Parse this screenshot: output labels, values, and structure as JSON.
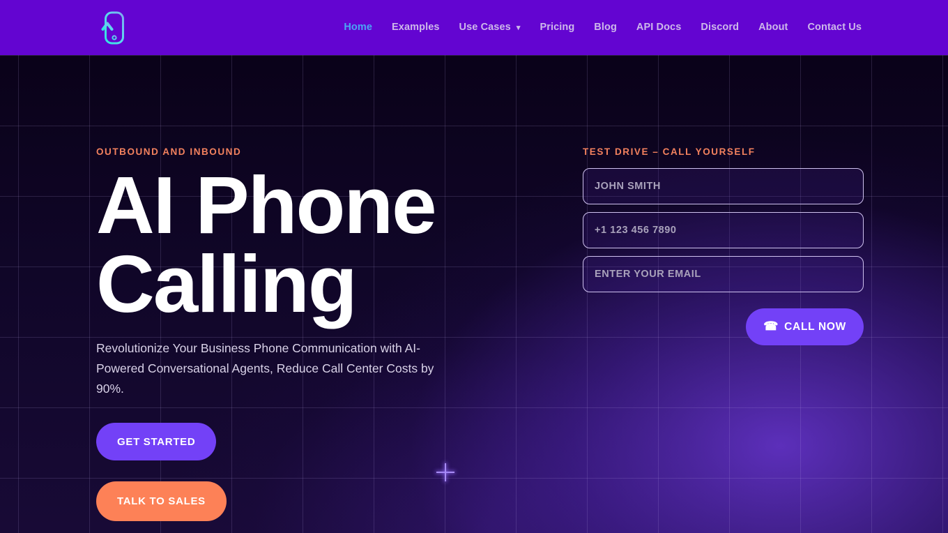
{
  "header": {
    "logo_name": "phone-up-arrow-logo",
    "background_color": "#6305d1",
    "nav": [
      {
        "label": "Home",
        "active": true
      },
      {
        "label": "Examples",
        "active": false
      },
      {
        "label": "Use Cases",
        "active": false,
        "has_dropdown": true,
        "caret_icon": "chevron-down-icon"
      },
      {
        "label": "Pricing",
        "active": false
      },
      {
        "label": "Blog",
        "active": false
      },
      {
        "label": "API Docs",
        "active": false
      },
      {
        "label": "Discord",
        "active": false
      },
      {
        "label": "About",
        "active": false
      },
      {
        "label": "Contact Us",
        "active": false
      }
    ]
  },
  "hero": {
    "eyebrow": "OUTBOUND AND INBOUND",
    "title": "AI Phone Calling",
    "subtitle": "Revolutionize Your Business Phone Communication with AI-Powered Conversational Agents, Reduce Call Center Costs by 90%.",
    "primary_button": "GET STARTED",
    "sales_button": "TALK TO SALES",
    "accent_color": "#f2815e",
    "primary_button_color": "#7341f7",
    "sales_button_color": "#fd8157"
  },
  "form": {
    "title": "TEST DRIVE – CALL YOURSELF",
    "fields": [
      {
        "name": "name",
        "placeholder": "JOHN SMITH",
        "value": ""
      },
      {
        "name": "phone",
        "placeholder": "+1 123 456 7890",
        "value": ""
      },
      {
        "name": "email",
        "placeholder": "ENTER YOUR EMAIL",
        "value": ""
      }
    ],
    "call_button": "CALL NOW",
    "call_button_icon": "telephone-icon",
    "call_button_glyph": "☎"
  }
}
